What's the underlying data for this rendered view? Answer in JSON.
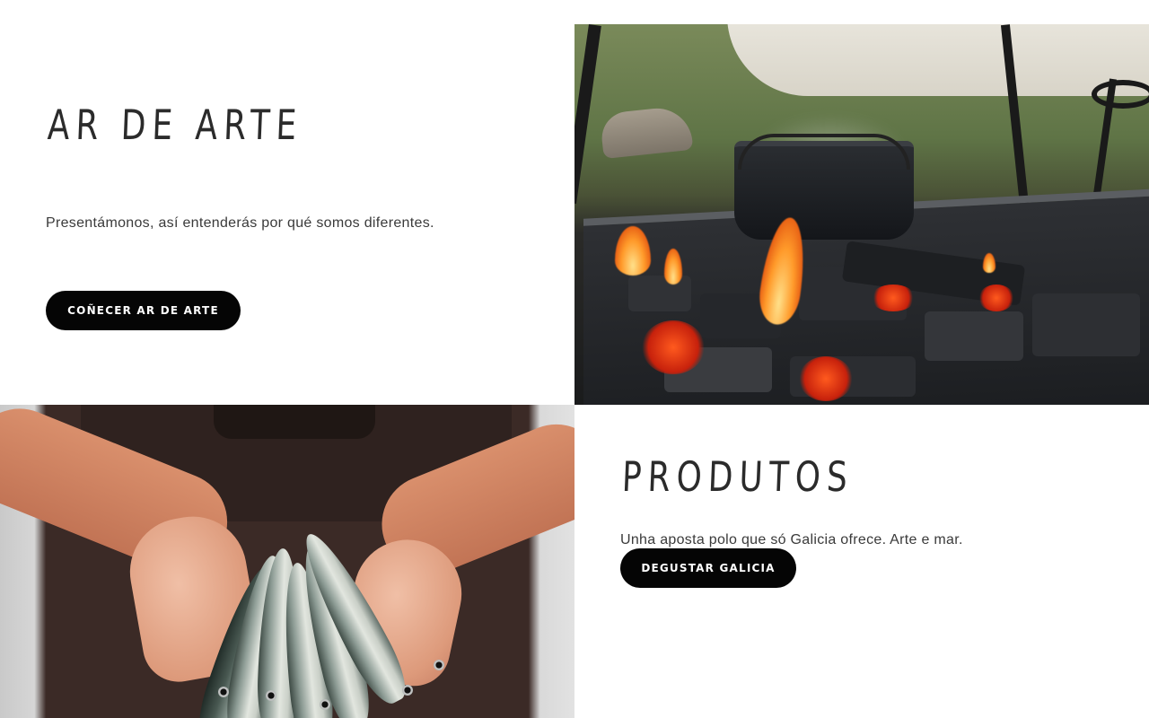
{
  "sections": {
    "about": {
      "title": "AR DE ARTE",
      "description": "Presentámonos, así entenderás por qué somos diferentes.",
      "button_label": "COÑECER AR DE ARTE"
    },
    "products": {
      "title": "PRODUTOS",
      "description": "Unha aposta polo que só Galicia ofrece. Arte e mar.",
      "button_label": "DEGUSTAR GALICIA"
    }
  },
  "images": {
    "fire_photo": "fire-pot-photo",
    "fish_photo": "fish-in-hands-photo"
  },
  "colors": {
    "background": "#ffffff",
    "button_bg": "#050505",
    "button_text": "#ffffff",
    "title_text": "#2b2b2b"
  }
}
